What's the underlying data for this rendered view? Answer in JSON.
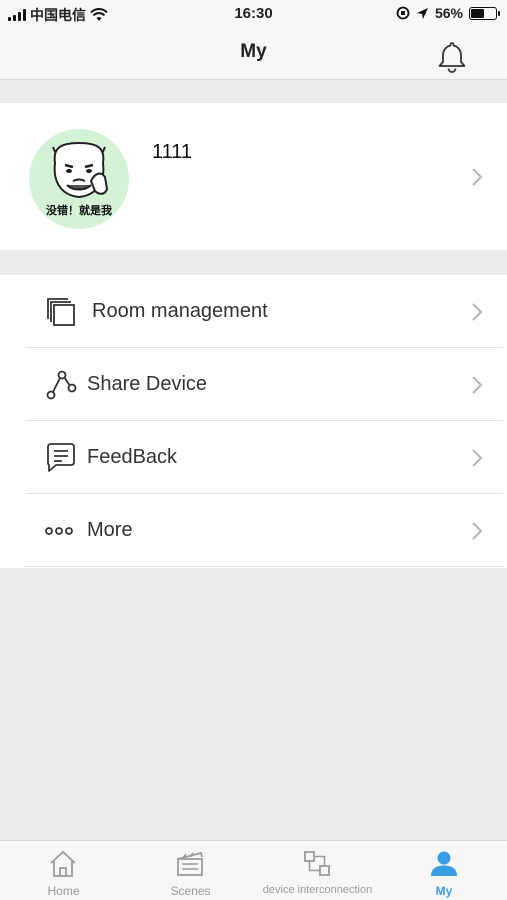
{
  "status_bar": {
    "carrier": "中国电信",
    "time": "16:30",
    "battery": "56%",
    "battery_level": 0.56
  },
  "nav": {
    "title": "My",
    "bell_icon": "bell-icon"
  },
  "profile": {
    "avatar_caption": "没错！就是我",
    "username": "1111"
  },
  "menu": {
    "items": [
      {
        "label": "Room management",
        "icon": "room-icon"
      },
      {
        "label": "Share Device",
        "icon": "share-icon"
      },
      {
        "label": "FeedBack",
        "icon": "feedback-icon"
      },
      {
        "label": "More",
        "icon": "more-icon"
      }
    ]
  },
  "tabs": [
    {
      "label": "Home",
      "icon": "home-icon",
      "active": false
    },
    {
      "label": "Scenes",
      "icon": "scenes-icon",
      "active": false
    },
    {
      "label": "device interconnection",
      "icon": "device-interconnection-icon",
      "active": false
    },
    {
      "label": "My",
      "icon": "user-icon",
      "active": true
    }
  ],
  "colors": {
    "accent": "#3a9ee4",
    "background": "#ebebeb",
    "avatar_bg": "#d4f3d6"
  }
}
